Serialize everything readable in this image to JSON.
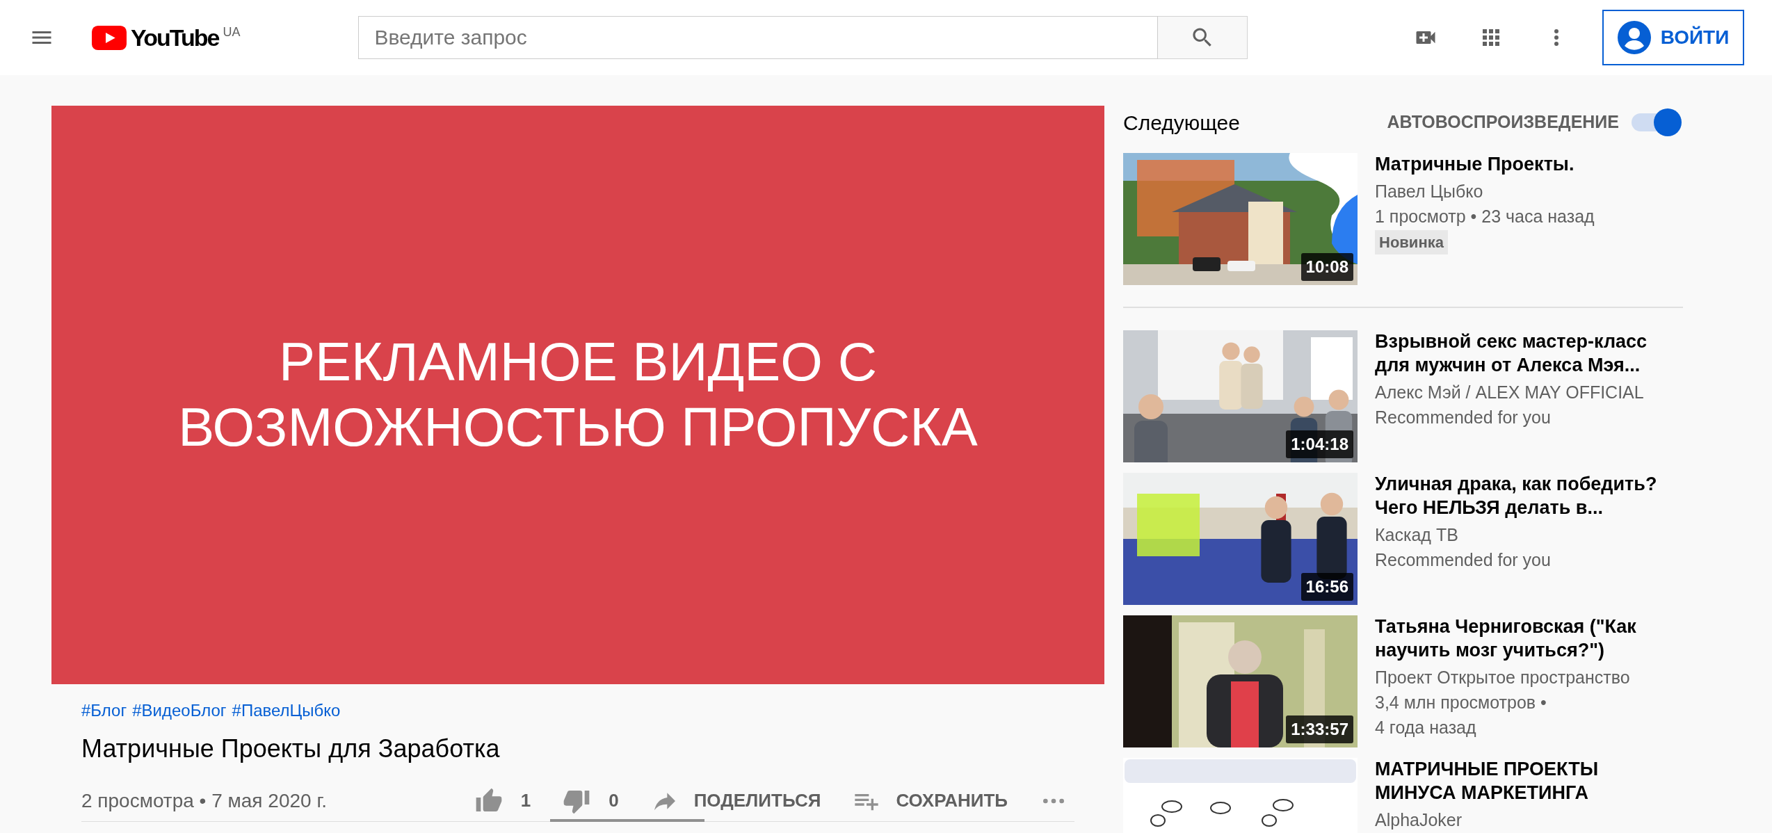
{
  "header": {
    "logo_text": "YouTube",
    "region": "UA",
    "search": {
      "placeholder": "Введите запрос"
    },
    "sign_in": "ВОЙТИ"
  },
  "player": {
    "ad_text": "РЕКЛАМНОЕ ВИДЕО С ВОЗМОЖНОСТЬЮ ПРОПУСКА"
  },
  "video": {
    "hashtags": [
      "#Блог",
      "#ВидеоБлог",
      "#ПавелЦыбко"
    ],
    "title": "Матричные Проекты для Заработка",
    "meta": "2 просмотра • 7 мая 2020 г.",
    "likes": "1",
    "dislikes": "0",
    "share": "ПОДЕЛИТЬСЯ",
    "save": "СОХРАНИТЬ",
    "rating_bar": {
      "level": 1
    }
  },
  "up_next": {
    "heading": "Следующее",
    "autoplay": {
      "label": "АВТОВОСПРОИЗВЕДЕНИЕ",
      "on": true
    },
    "items": [
      {
        "title": "Матричные Проекты.",
        "channel": "Павел Цыбко",
        "meta": [
          "1 просмотр • 23 часа назад"
        ],
        "badge": "Новинка",
        "duration": "10:08"
      },
      {
        "title": "Взрывной секс мастер-класс для мужчин от Алекса Мэя...",
        "channel": "Алекс Мэй / ALEX MAY OFFICIAL",
        "meta": [
          "Recommended for you"
        ],
        "duration": "1:04:18"
      },
      {
        "title": "Уличная драка, как победить? Чего НЕЛЬЗЯ делать в...",
        "channel": "Каскад ТВ",
        "meta": [
          "Recommended for you"
        ],
        "duration": "16:56"
      },
      {
        "title": "Татьяна Черниговская (\"Как научить мозг учиться?\")",
        "channel": "Проект Открытое пространство",
        "meta": [
          "3,4 млн просмотров •",
          "4 года назад"
        ],
        "duration": "1:33:57"
      },
      {
        "title": "МАТРИЧНЫЕ ПРОЕКТЫ МИНУСА МАРКЕТИНГА",
        "channel": "AlphaJoker"
      }
    ]
  }
}
